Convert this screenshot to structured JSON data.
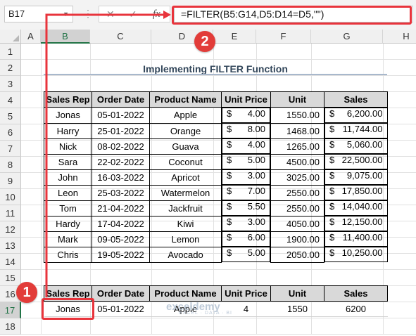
{
  "formula_bar": {
    "name_box": "B17",
    "cancel_icon": "✕",
    "enter_icon": "✓",
    "fx_label": "fx",
    "formula": "=FILTER(B5:G14,D5:D14=D5,\"\")"
  },
  "columns": [
    "A",
    "B",
    "C",
    "D",
    "E",
    "F",
    "G",
    "H"
  ],
  "rows": [
    "1",
    "2",
    "3",
    "4",
    "5",
    "6",
    "7",
    "8",
    "9",
    "10",
    "11",
    "12",
    "13",
    "14",
    "15",
    "16",
    "17",
    "18"
  ],
  "selected_cell": "B17",
  "title": "Implementing FILTER Function",
  "dataset": {
    "headers": [
      "Sales Rep",
      "Order Date",
      "Product Name",
      "Unit Price",
      "Unit",
      "Sales"
    ],
    "currency_symbol": "$",
    "rows": [
      [
        "Jonas",
        "05-01-2022",
        "Apple",
        "4.00",
        "1550.00",
        "6,200.00"
      ],
      [
        "Harry",
        "25-01-2022",
        "Orange",
        "8.00",
        "1468.00",
        "11,744.00"
      ],
      [
        "Nick",
        "08-02-2022",
        "Guava",
        "4.00",
        "1265.00",
        "5,060.00"
      ],
      [
        "Sara",
        "22-02-2022",
        "Coconut",
        "5.00",
        "4500.00",
        "22,500.00"
      ],
      [
        "John",
        "16-03-2022",
        "Apricot",
        "3.00",
        "3025.00",
        "9,075.00"
      ],
      [
        "Leon",
        "25-03-2022",
        "Watermelon",
        "7.00",
        "2550.00",
        "17,850.00"
      ],
      [
        "Tom",
        "21-04-2022",
        "Jackfruit",
        "5.50",
        "2550.00",
        "14,040.00"
      ],
      [
        "Hardy",
        "17-04-2022",
        "Kiwi",
        "3.00",
        "4050.00",
        "12,150.00"
      ],
      [
        "Mark",
        "09-05-2022",
        "Lemon",
        "6.00",
        "1900.00",
        "11,400.00"
      ],
      [
        "Chris",
        "19-05-2022",
        "Avocado",
        "5.00",
        "2050.00",
        "10,250.00"
      ]
    ]
  },
  "result": {
    "headers": [
      "Sales Rep",
      "Order Date",
      "Product Name",
      "Unit Price",
      "Unit",
      "Sales"
    ],
    "row": [
      "Jonas",
      "05-01-2022",
      "Apple",
      "4",
      "1550",
      "6200"
    ]
  },
  "annotations": {
    "badge_1": "1",
    "badge_2": "2",
    "accent_color": "#e8343c"
  },
  "watermark": {
    "name": "exceldemy",
    "tagline": "EXCEL · DATA · BI"
  },
  "colors": {
    "header_fill": "#d9d9d9",
    "title_color": "#33475b",
    "excel_green": "#217346"
  }
}
